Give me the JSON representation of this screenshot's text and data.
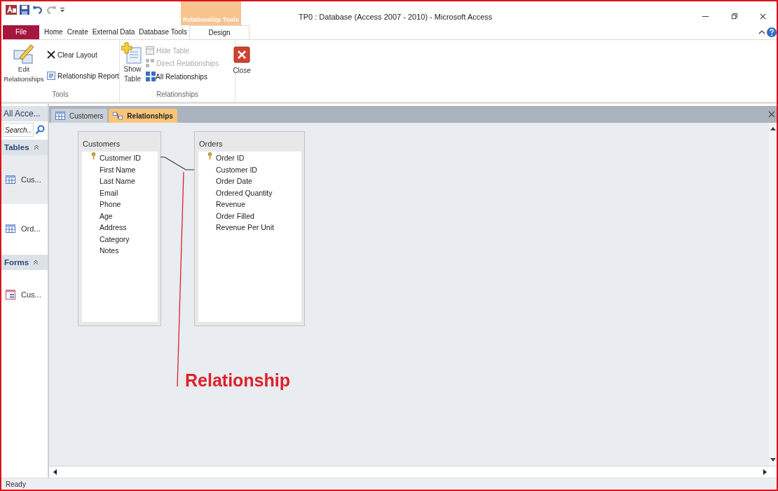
{
  "window": {
    "title": "TP0 : Database (Access 2007 - 2010) - Microsoft Access"
  },
  "ribbon": {
    "contextual_label": "Relationship Tools",
    "tabs": [
      {
        "label": "File",
        "kind": "file",
        "selected": false
      },
      {
        "label": "Home",
        "kind": "plain",
        "selected": false
      },
      {
        "label": "Create",
        "kind": "plain",
        "selected": false
      },
      {
        "label": "External Data",
        "kind": "plain",
        "selected": false
      },
      {
        "label": "Database Tools",
        "kind": "plain",
        "selected": false
      },
      {
        "label": "Design",
        "kind": "contextual",
        "selected": true
      }
    ],
    "groups": [
      {
        "label": "Tools",
        "buttons": [
          {
            "label": "Edit Relationships",
            "disabled": false
          },
          {
            "label": "Clear Layout",
            "disabled": false
          },
          {
            "label": "Relationship Report",
            "disabled": false
          }
        ]
      },
      {
        "label": "Relationships",
        "buttons": [
          {
            "label": "Show Table",
            "disabled": false
          },
          {
            "label": "Hide Table",
            "disabled": true
          },
          {
            "label": "Direct Relationships",
            "disabled": true
          },
          {
            "label": "All Relationships",
            "disabled": false
          },
          {
            "label": "Close",
            "disabled": false
          }
        ]
      }
    ]
  },
  "nav_pane": {
    "title": "All Acce...",
    "search": {
      "placeholder": "Search..."
    },
    "groups": [
      {
        "label": "Tables",
        "items": [
          {
            "label": "Cus...",
            "kind": "table",
            "selected": true
          },
          {
            "label": "Ord...",
            "kind": "table",
            "selected": false
          }
        ]
      },
      {
        "label": "Forms",
        "items": [
          {
            "label": "Cus...",
            "kind": "form",
            "selected": false
          }
        ]
      }
    ]
  },
  "document_tabs": [
    {
      "label": "Customers",
      "kind": "table",
      "selected": false
    },
    {
      "label": "Relationships",
      "kind": "relationships",
      "selected": true
    }
  ],
  "diagram": {
    "tables": [
      {
        "title": "Customers",
        "fields": [
          {
            "name": "Customer ID",
            "primary_key": true
          },
          {
            "name": "First Name",
            "primary_key": false
          },
          {
            "name": "Last Name",
            "primary_key": false
          },
          {
            "name": "Email",
            "primary_key": false
          },
          {
            "name": "Phone",
            "primary_key": false
          },
          {
            "name": "Age",
            "primary_key": false
          },
          {
            "name": "Address",
            "primary_key": false
          },
          {
            "name": "Category",
            "primary_key": false
          },
          {
            "name": "Notes",
            "primary_key": false
          }
        ]
      },
      {
        "title": "Orders",
        "fields": [
          {
            "name": "Order ID",
            "primary_key": true
          },
          {
            "name": "Customer ID",
            "primary_key": false
          },
          {
            "name": "Order Date",
            "primary_key": false
          },
          {
            "name": "Ordered Quantity",
            "primary_key": false
          },
          {
            "name": "Revenue",
            "primary_key": false
          },
          {
            "name": "Order Filled",
            "primary_key": false
          },
          {
            "name": "Revenue Per Unit",
            "primary_key": false
          }
        ]
      }
    ],
    "annotation": {
      "text": "Relationship"
    }
  },
  "status_bar": {
    "text": "Ready"
  }
}
